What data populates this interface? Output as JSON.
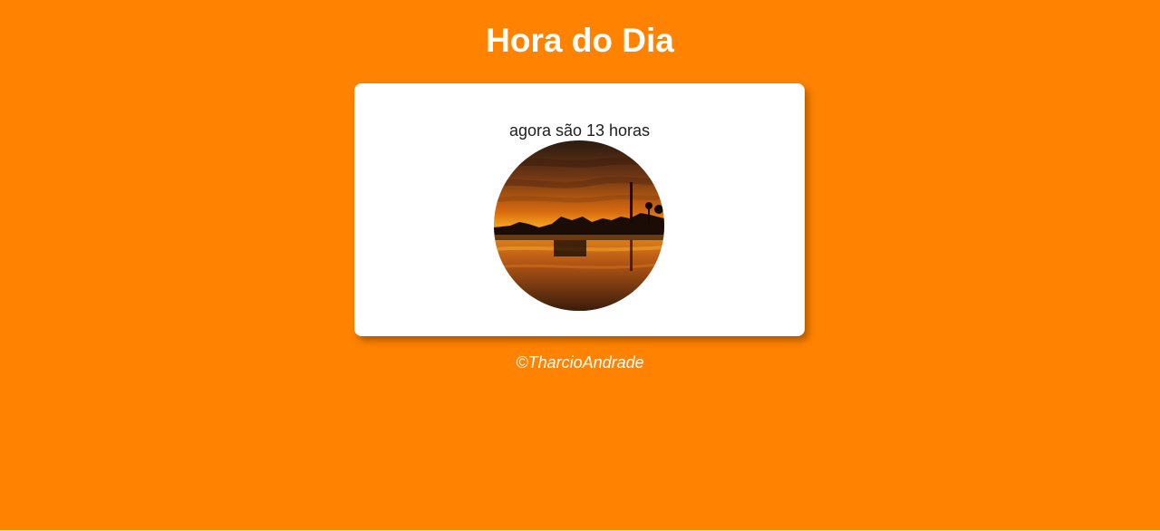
{
  "page": {
    "title": "Hora do Dia",
    "background_color": "#ff8300"
  },
  "card": {
    "message": "agora são 13 horas",
    "image_icon": "sunset-photo"
  },
  "footer": {
    "credit": "©TharcioAndrade"
  }
}
